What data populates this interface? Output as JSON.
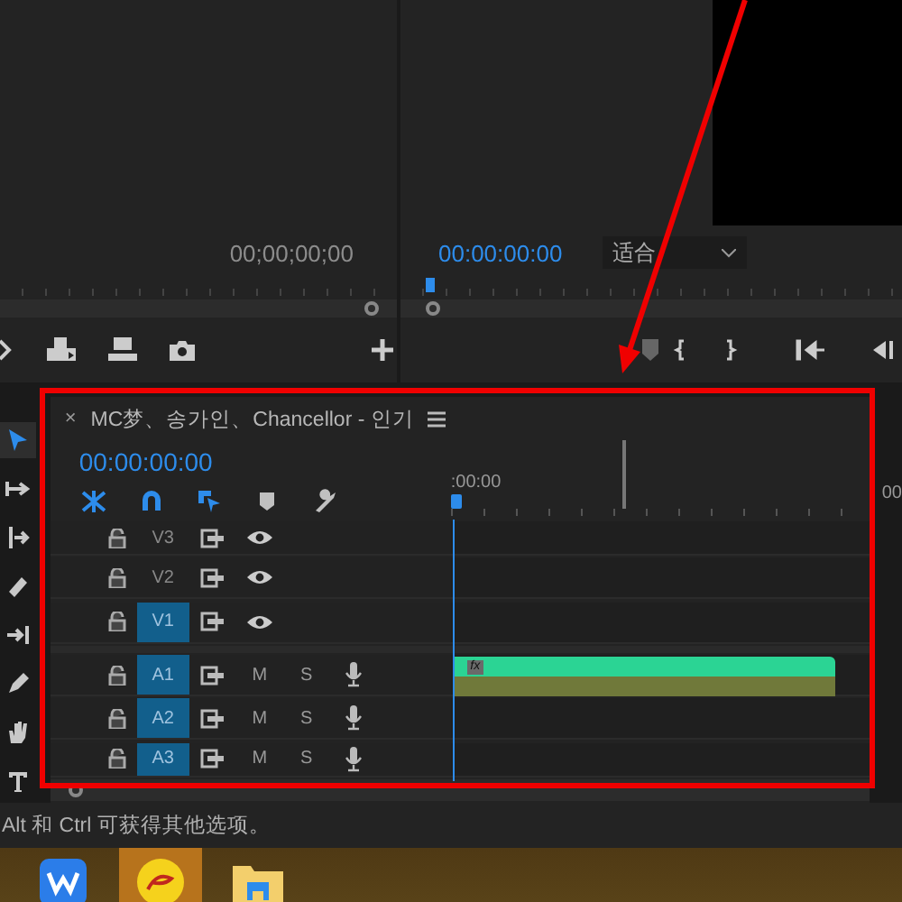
{
  "source_monitor": {
    "timecode": "00;00;00;00"
  },
  "program_monitor": {
    "timecode": "00:00:00:00",
    "fit_dropdown": {
      "value": "适合"
    }
  },
  "tools": [
    {
      "kind": "selection",
      "selected": true
    },
    {
      "kind": "track-select",
      "selected": false
    },
    {
      "kind": "ripple",
      "selected": false
    },
    {
      "kind": "razor",
      "selected": false
    },
    {
      "kind": "slip",
      "selected": false
    },
    {
      "kind": "pen",
      "selected": false
    },
    {
      "kind": "hand",
      "selected": false
    },
    {
      "kind": "type",
      "selected": false
    }
  ],
  "timeline": {
    "close": "×",
    "title": "MC梦、송가인、Chancellor - 인기",
    "timecode": "00:00:00:00",
    "ruler_label": ":00:00",
    "toggles": [
      {
        "kind": "nest",
        "on": true
      },
      {
        "kind": "snap",
        "on": true
      },
      {
        "kind": "linked",
        "on": true
      },
      {
        "kind": "marker",
        "on": false
      },
      {
        "kind": "settings",
        "on": false
      }
    ],
    "tracks": [
      {
        "kind": "video",
        "name": "V3",
        "targeted": false
      },
      {
        "kind": "video",
        "name": "V2",
        "targeted": false
      },
      {
        "kind": "video",
        "name": "V1",
        "targeted": true
      },
      {
        "kind": "audio",
        "name": "A1",
        "targeted": true,
        "mute": "M",
        "solo": "S",
        "clip": {
          "badge": "fx"
        }
      },
      {
        "kind": "audio",
        "name": "A2",
        "targeted": true,
        "mute": "M",
        "solo": "S"
      },
      {
        "kind": "audio",
        "name": "A3",
        "targeted": true,
        "mute": "M",
        "solo": "S"
      }
    ]
  },
  "side_panel": {
    "ruler_label": "00"
  },
  "status_bar": {
    "text": "Alt 和 Ctrl 可获得其他选项。"
  },
  "taskbar": {
    "apps": [
      {
        "kind": "wps",
        "active": false
      },
      {
        "kind": "pask",
        "active": true
      },
      {
        "kind": "folder",
        "active": false
      }
    ]
  }
}
